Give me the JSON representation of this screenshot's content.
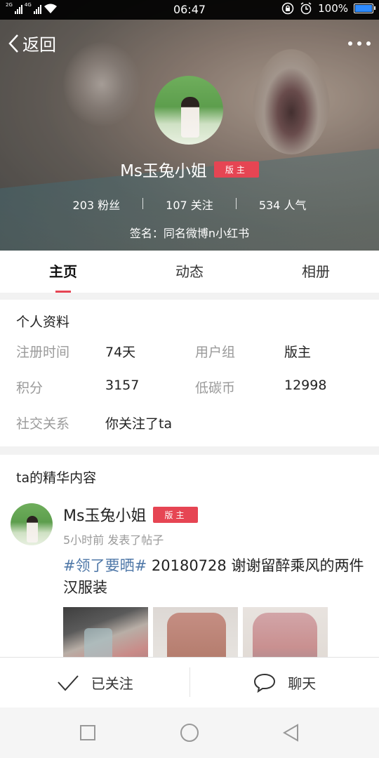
{
  "status_bar": {
    "net_left": "2G",
    "net_right": "4G",
    "time": "06:47",
    "battery": "100%"
  },
  "header": {
    "back_label": "返回"
  },
  "profile": {
    "name": "Ms玉兔小姐",
    "badge": "版主",
    "stats": {
      "fans": "203 粉丝",
      "following": "107 关注",
      "popularity": "534 人气"
    },
    "signature": "签名：同名微博n小红书"
  },
  "tabs": [
    {
      "label": "主页",
      "active": true
    },
    {
      "label": "动态",
      "active": false
    },
    {
      "label": "相册",
      "active": false
    }
  ],
  "info": {
    "title": "个人资料",
    "register_label": "注册时间",
    "register_value": "74天",
    "group_label": "用户组",
    "group_value": "版主",
    "points_label": "积分",
    "points_value": "3157",
    "currency_label": "低碳币",
    "currency_value": "12998",
    "relation_label": "社交关系",
    "relation_value": "你关注了ta"
  },
  "featured": {
    "title": "ta的精华内容",
    "post": {
      "author": "Ms玉兔小姐",
      "badge": "版主",
      "meta": "5小时前 发表了帖子",
      "topic": "#领了要晒#",
      "text": " 20180728 谢谢留醉乘风的两件汉服装"
    }
  },
  "actions": {
    "follow_label": "已关注",
    "chat_label": "聊天"
  },
  "colors": {
    "accent": "#e64553",
    "topic": "#4f78a8",
    "battery": "#2e8bff"
  },
  "icons": [
    "back-chevron-icon",
    "more-dots-icon",
    "check-icon",
    "chat-bubble-icon",
    "nav-square-icon",
    "nav-circle-icon",
    "nav-triangle-icon"
  ]
}
